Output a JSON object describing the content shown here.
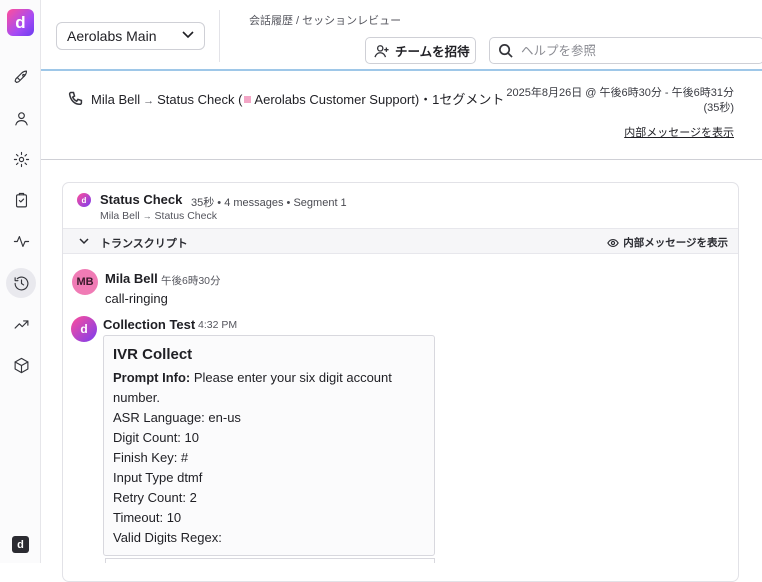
{
  "rail": {
    "logo_letter": "d",
    "items": [
      "rocket-icon",
      "person-icon",
      "gear-icon",
      "clipboard-icon",
      "activity-icon",
      "history-icon",
      "trend-icon",
      "cube-icon"
    ],
    "active": "history-icon",
    "bottom_letter": "d"
  },
  "header": {
    "workspace": "Aerolabs Main",
    "breadcrumb": "会話履歴 / セッションレビュー",
    "invite_label": "チームを招待",
    "search_placeholder": "ヘルプを参照"
  },
  "call": {
    "caller": "Mila Bell",
    "flow": "Status Check",
    "open_paren": "(",
    "agent": "Aerolabs Customer Support",
    "close_suffix": ")・1セグメント",
    "date_range": "2025年8月26日 @ 午後6時30分 - 午後6時31分 (35秒)",
    "show_internal": "内部メッセージを表示"
  },
  "segment": {
    "title": "Status Check",
    "meta": "35秒 • 4 messages • Segment 1",
    "route_from": "Mila Bell",
    "route_to": "Status Check",
    "transcript_label": "トランスクリプト",
    "show_internal": "内部メッセージを表示"
  },
  "messages": [
    {
      "initials": "MB",
      "name": "Mila Bell",
      "time": "午後6時30分",
      "text": "call-ringing"
    },
    {
      "initials": "d",
      "name": "Collection Test",
      "time": "4:32 PM"
    }
  ],
  "ivr": {
    "title": "IVR Collect",
    "prompt_label": "Prompt Info:",
    "prompt_text": " Please enter your six digit account number.",
    "lines": [
      "ASR Language: en-us",
      "Digit Count: 10",
      "Finish Key: #",
      "Input Type dtmf",
      "Retry Count: 2",
      "Timeout: 10",
      "Valid Digits Regex:"
    ]
  },
  "colors": {
    "brand_pink": "#ff4f9a",
    "brand_purple": "#7a3cf0",
    "accent_line": "#9ec7e8"
  }
}
